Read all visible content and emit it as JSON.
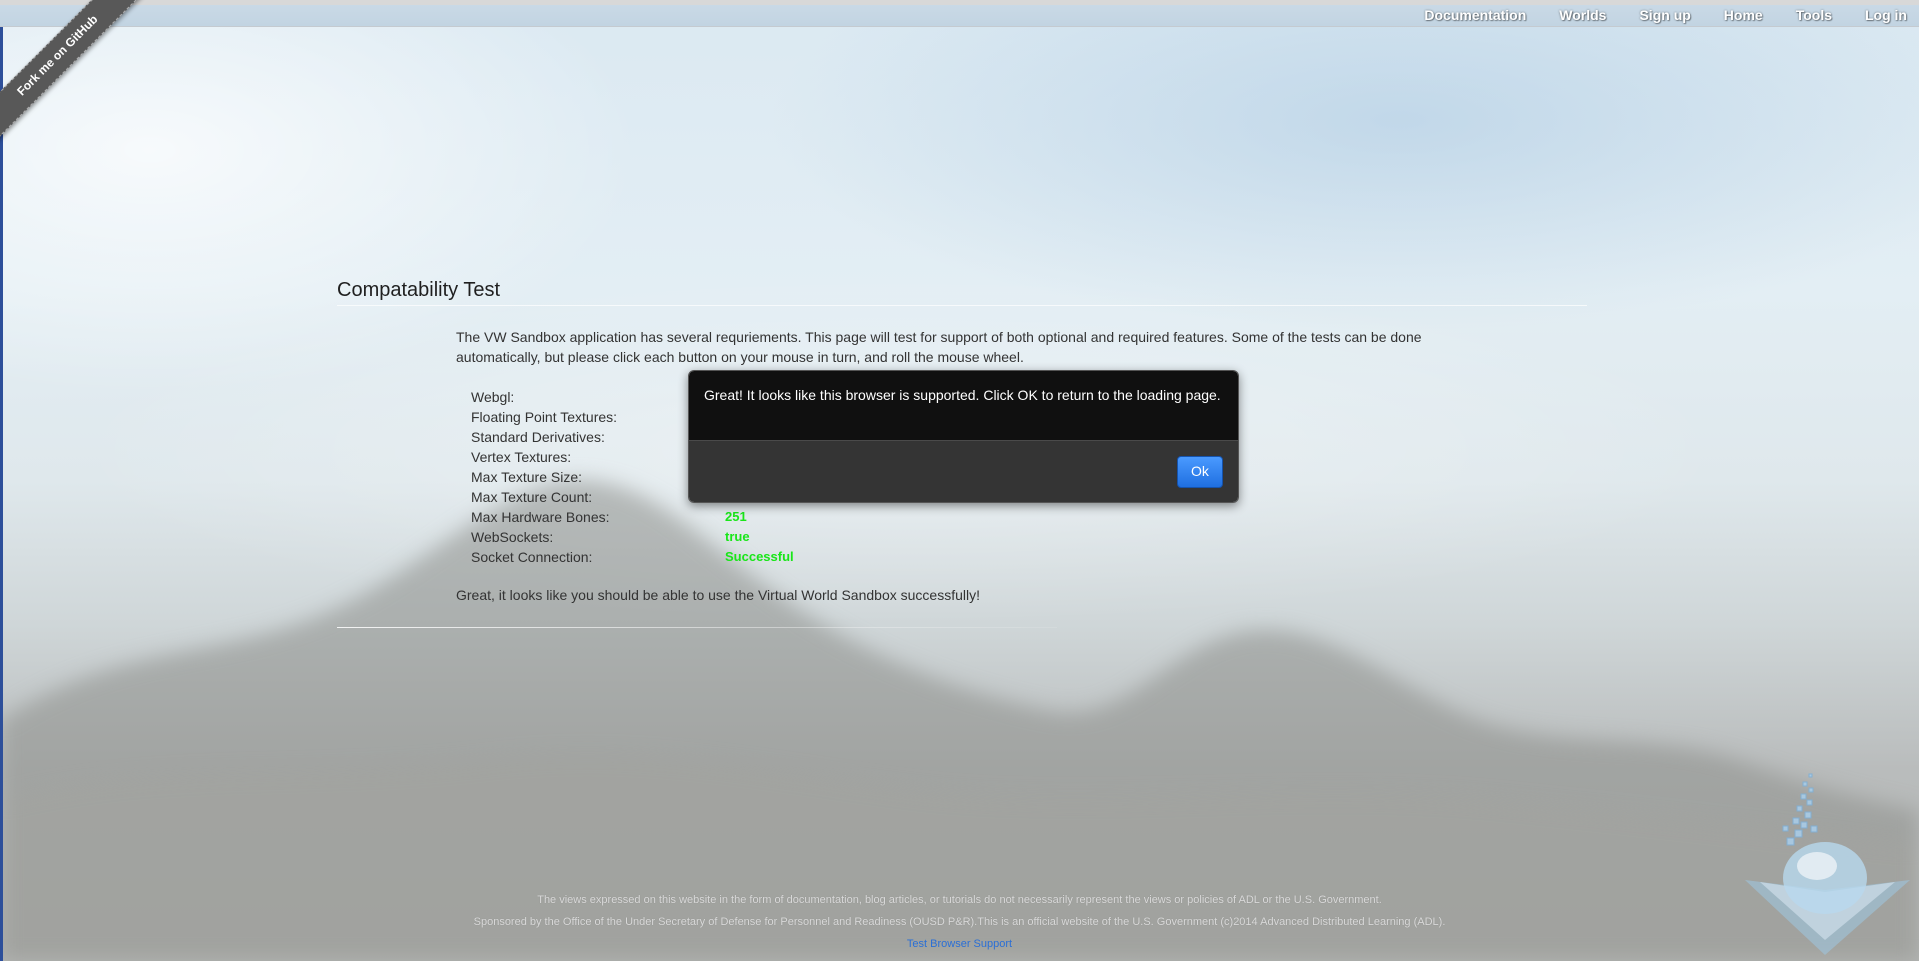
{
  "nav": {
    "items": [
      "Documentation",
      "Worlds",
      "Sign up",
      "Home",
      "Tools",
      "Log in"
    ]
  },
  "ribbon": {
    "label": "Fork me on GitHub"
  },
  "page": {
    "title": "Compatability Test",
    "intro": "The VW Sandbox application has several requriements. This page will test for support of both optional and required features. Some of the tests can be done automatically, but please click each button on your mouse in turn, and roll the mouse wheel.",
    "tests": [
      {
        "label": "Webgl:",
        "value": ""
      },
      {
        "label": "Floating Point Textures:",
        "value": ""
      },
      {
        "label": "Standard Derivatives:",
        "value": ""
      },
      {
        "label": "Vertex Textures:",
        "value": ""
      },
      {
        "label": "Max Texture Size:",
        "value": ""
      },
      {
        "label": "Max Texture Count:",
        "value": ""
      },
      {
        "label": "Max Hardware Bones:",
        "value": "251"
      },
      {
        "label": "WebSockets:",
        "value": "true"
      },
      {
        "label": "Socket Connection:",
        "value": "Successful"
      }
    ],
    "result": "Great, it looks like you should be able to use the Virtual World Sandbox successfully!"
  },
  "modal": {
    "message": "Great! It looks like this browser is supported. Click OK to return to the loading page.",
    "ok_label": "Ok"
  },
  "footer": {
    "line1": "The views expressed on this website in the form of documentation, blog articles, or tutorials do not necessarily represent the views or policies of ADL or the U.S. Government.",
    "line2": "Sponsored by the Office of the Under Secretary of Defense for Personnel and Readiness (OUSD P&R).This is an official website of the U.S. Government (c)2014 Advanced Distributed Learning (ADL).",
    "link": "Test Browser Support"
  },
  "colors": {
    "pass_value": "#19e619",
    "ok_button": "#2a7cf0",
    "modal_body": "#101010",
    "link": "#2b6fd6"
  },
  "icons": {
    "logo": "vwf-sandbox-logo-icon"
  }
}
